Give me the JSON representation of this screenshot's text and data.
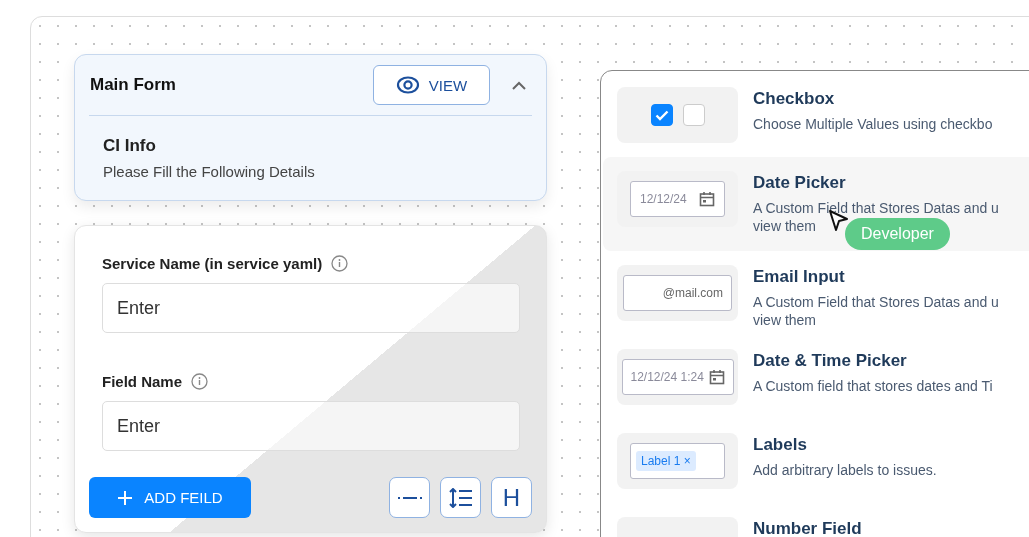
{
  "main_form": {
    "title": "Main Form",
    "view_button": "VIEW",
    "expanded": true,
    "section_title": "CI Info",
    "section_subtitle": "Please Fill the Following Details"
  },
  "fields": [
    {
      "label": "Service Name (in service yaml)",
      "placeholder": "Enter"
    },
    {
      "label": "Field Name",
      "placeholder": "Enter"
    }
  ],
  "add_button": "ADD FEILD",
  "toolbar_buttons": [
    {
      "kind": "divider"
    },
    {
      "kind": "line-spacing"
    },
    {
      "kind": "heading",
      "text": "H"
    }
  ],
  "field_types": [
    {
      "kind": "checkbox",
      "title": "Checkbox",
      "description": [
        "Choose Multiple Values using checkbo"
      ],
      "selected": false,
      "checkboxes": [
        {
          "checked": true
        },
        {
          "checked": false
        }
      ]
    },
    {
      "kind": "date",
      "title": "Date Picker",
      "description": [
        "A Custom Field that Stores Datas and u",
        "view them"
      ],
      "selected": true,
      "preview": "12/12/24"
    },
    {
      "kind": "email",
      "title": "Email Input",
      "description": [
        "A Custom Field that Stores Datas and u",
        "view them"
      ],
      "selected": false,
      "preview": "@mail.com"
    },
    {
      "kind": "datetime",
      "title": "Date & Time Picker",
      "description": [
        "A Custom field that stores dates and Ti"
      ],
      "selected": false,
      "preview": "12/12/24 1:24"
    },
    {
      "kind": "labels",
      "title": "Labels",
      "description": [
        "Add arbitrary labels to issues."
      ],
      "selected": false,
      "preview": "Label 1",
      "chip_close": "×"
    },
    {
      "kind": "number",
      "title": "Number Field",
      "selected": false
    }
  ],
  "cursor_badge": "Developer"
}
